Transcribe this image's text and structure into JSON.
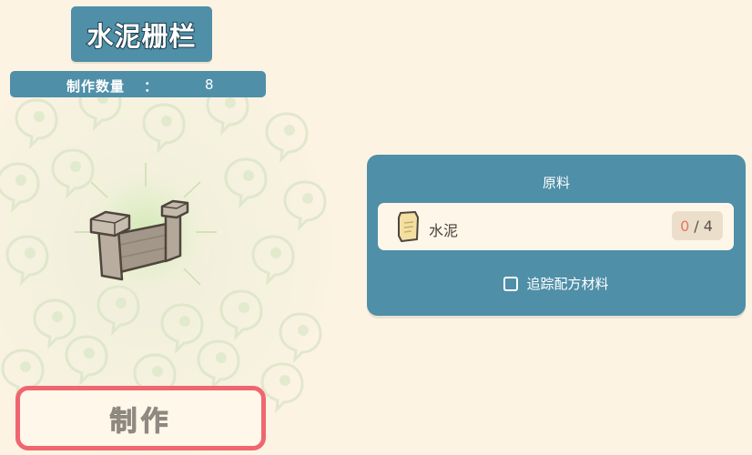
{
  "item": {
    "title": "水泥栅栏",
    "quantity_label": "制作数量",
    "quantity_colon": "：",
    "quantity_value": "8"
  },
  "craft": {
    "button_label": "制作"
  },
  "materials": {
    "header": "原料",
    "items": [
      {
        "name": "水泥",
        "have": "0",
        "separator": "/",
        "need": "4",
        "icon": "cement-bag-icon"
      }
    ],
    "track_label": "追踪配方材料",
    "track_checked": false
  },
  "colors": {
    "background": "#fdf3e3",
    "panel": "#4f8fa8",
    "craft_border": "#f06670",
    "have_count": "#e77760"
  }
}
